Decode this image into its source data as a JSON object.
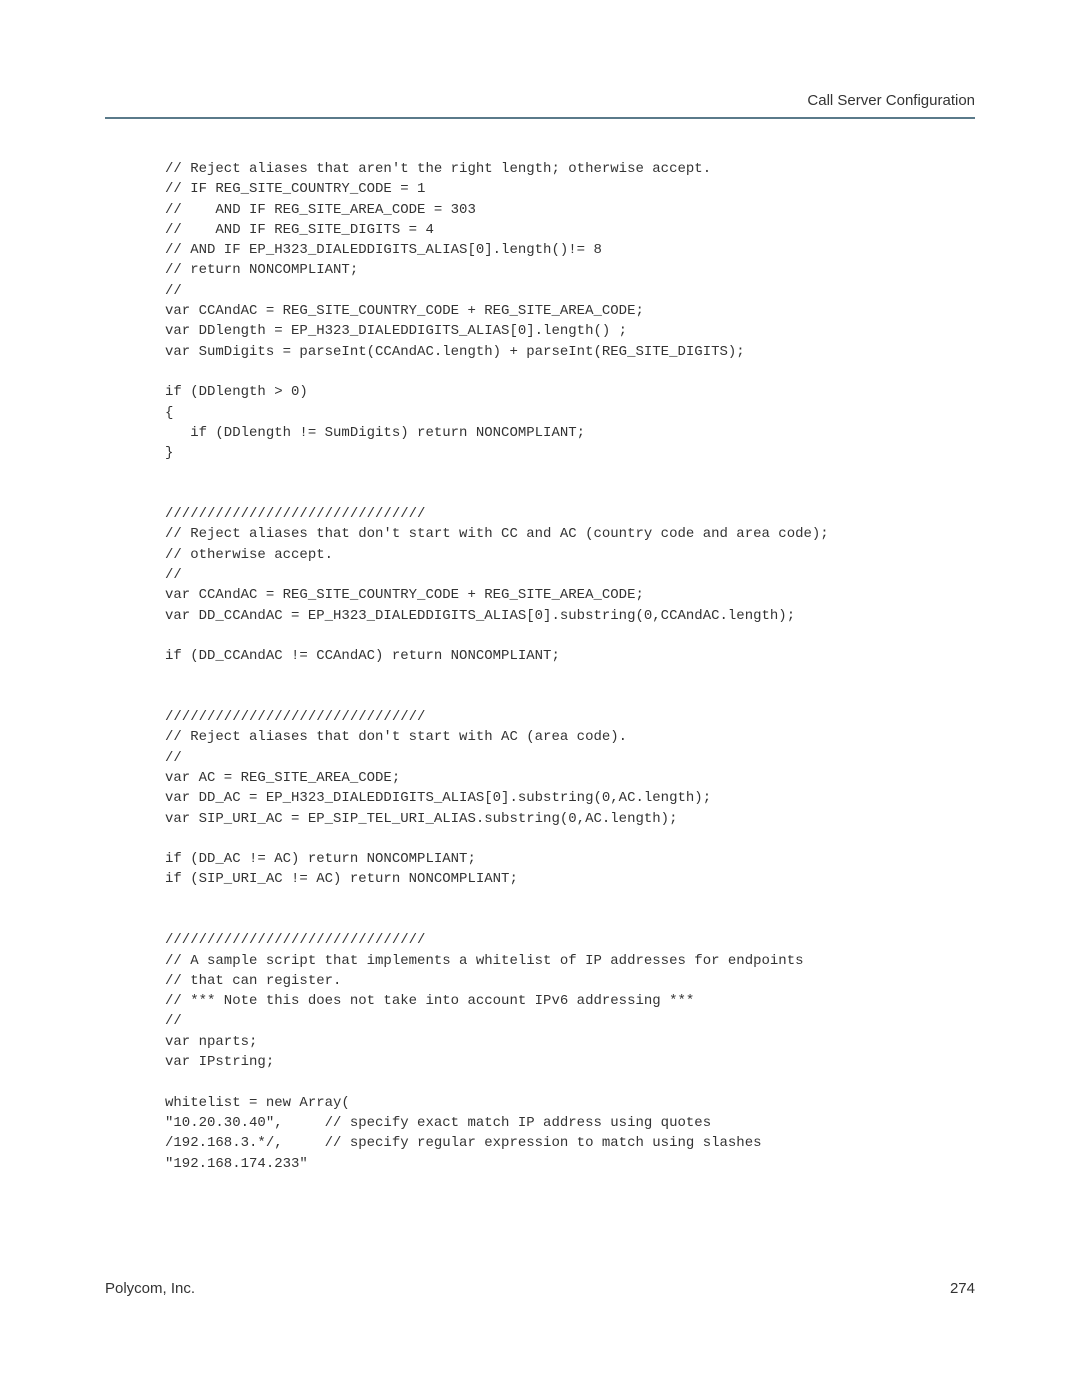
{
  "header": {
    "title": "Call Server Configuration"
  },
  "code": {
    "text": "// Reject aliases that aren't the right length; otherwise accept.\n// IF REG_SITE_COUNTRY_CODE = 1\n//    AND IF REG_SITE_AREA_CODE = 303\n//    AND IF REG_SITE_DIGITS = 4\n// AND IF EP_H323_DIALEDDIGITS_ALIAS[0].length()!= 8\n// return NONCOMPLIANT;\n//\nvar CCAndAC = REG_SITE_COUNTRY_CODE + REG_SITE_AREA_CODE;\nvar DDlength = EP_H323_DIALEDDIGITS_ALIAS[0].length() ;\nvar SumDigits = parseInt(CCAndAC.length) + parseInt(REG_SITE_DIGITS);\n\nif (DDlength > 0)\n{\n   if (DDlength != SumDigits) return NONCOMPLIANT;\n}\n\n\n///////////////////////////////\n// Reject aliases that don't start with CC and AC (country code and area code);\n// otherwise accept.\n//\nvar CCAndAC = REG_SITE_COUNTRY_CODE + REG_SITE_AREA_CODE;\nvar DD_CCAndAC = EP_H323_DIALEDDIGITS_ALIAS[0].substring(0,CCAndAC.length);\n\nif (DD_CCAndAC != CCAndAC) return NONCOMPLIANT;\n\n\n///////////////////////////////\n// Reject aliases that don't start with AC (area code).\n//\nvar AC = REG_SITE_AREA_CODE;\nvar DD_AC = EP_H323_DIALEDDIGITS_ALIAS[0].substring(0,AC.length);\nvar SIP_URI_AC = EP_SIP_TEL_URI_ALIAS.substring(0,AC.length);\n\nif (DD_AC != AC) return NONCOMPLIANT;\nif (SIP_URI_AC != AC) return NONCOMPLIANT;\n\n\n///////////////////////////////\n// A sample script that implements a whitelist of IP addresses for endpoints\n// that can register.\n// *** Note this does not take into account IPv6 addressing ***\n//\nvar nparts;\nvar IPstring;\n\nwhitelist = new Array(\n\"10.20.30.40\",     // specify exact match IP address using quotes\n/192.168.3.*/,     // specify regular expression to match using slashes\n\"192.168.174.233\""
  },
  "footer": {
    "company": "Polycom, Inc.",
    "page": "274"
  }
}
